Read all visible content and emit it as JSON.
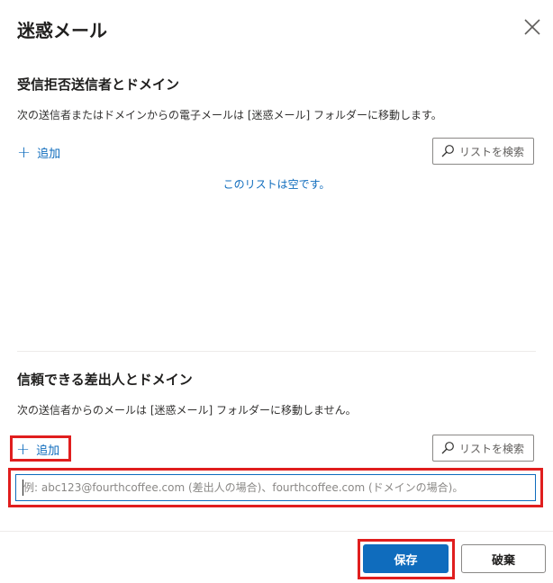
{
  "dialog": {
    "title": "迷惑メール",
    "close_icon": "close-icon"
  },
  "blocked": {
    "heading": "受信拒否送信者とドメイン",
    "description": "次の送信者またはドメインからの電子メールは [迷惑メール] フォルダーに移動します。",
    "add_label": "追加",
    "search_placeholder": "リストを検索",
    "empty_message": "このリストは空です。"
  },
  "safe": {
    "heading": "信頼できる差出人とドメイン",
    "description": "次の送信者からのメールは [迷惑メール] フォルダーに移動しません。",
    "add_label": "追加",
    "search_placeholder": "リストを検索",
    "input_value": "",
    "input_placeholder": "例: abc123@fourthcoffee.com (差出人の場合)、fourthcoffee.com (ドメインの場合)。"
  },
  "footer": {
    "save_label": "保存",
    "cancel_label": "破棄"
  },
  "colors": {
    "accent": "#0f6cbd",
    "highlight": "#e01e1e"
  }
}
